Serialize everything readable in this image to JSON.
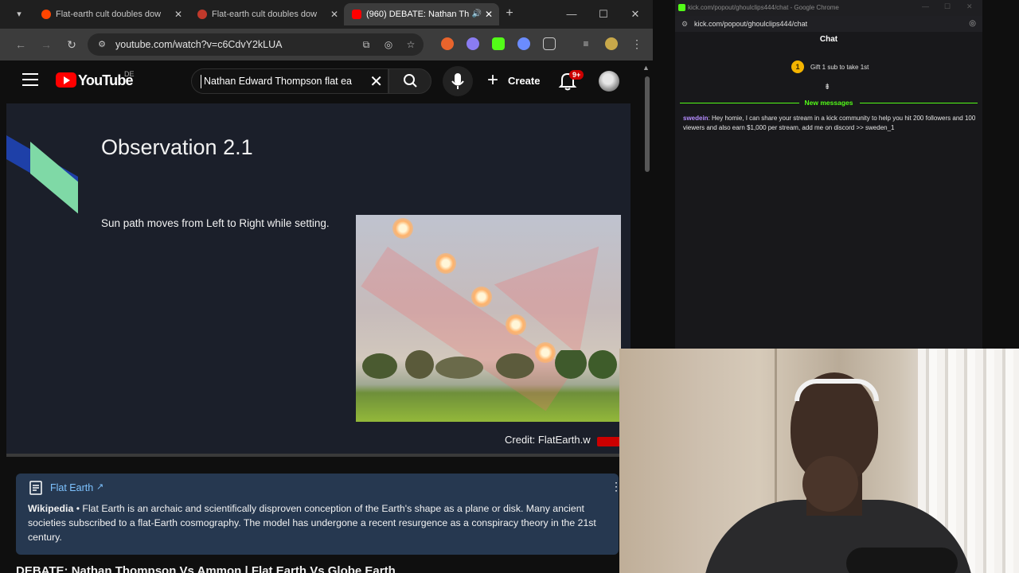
{
  "browser": {
    "tabs": [
      {
        "title": "Flat-earth cult doubles dow",
        "favicon_color": "#ff4500",
        "active": false
      },
      {
        "title": "Flat-earth cult doubles dow",
        "favicon_color": "#c0392b",
        "active": false
      },
      {
        "title": "(960) DEBATE: Nathan Th",
        "favicon_color": "#ff0000",
        "active": true
      }
    ],
    "url": "youtube.com/watch?v=c6CdvY2kLUA"
  },
  "youtube": {
    "logo_text": "YouTube",
    "region": "DE",
    "search_query": "Nathan Edward Thompson flat ea",
    "create_label": "Create",
    "notification_badge": "9+"
  },
  "video": {
    "slide_title": "Observation 2.1",
    "slide_subtitle": "Sun path moves from Left to Right while setting.",
    "credit": "Credit: FlatEarth.w"
  },
  "info_panel": {
    "link_text": "Flat Earth",
    "source": "Wikipedia",
    "description": " • Flat Earth is an archaic and scientifically disproven conception of the Earth's shape as a plane or disk. Many ancient societies subscribed to a flat-Earth cosmography. The model has undergone a recent resurgence as a conspiracy theory in the 21st century."
  },
  "video_title": "DEBATE: Nathan Thompson Vs Ammon | Flat Earth Vs Globe Earth",
  "chat_window": {
    "window_title": "kick.com/popout/ghoulclips444/chat - Google Chrome",
    "url": "kick.com/popout/ghoulclips444/chat",
    "header": "Chat",
    "gift_badge": "1",
    "gift_text": "Gift 1 sub to take 1st",
    "new_messages_label": "New messages",
    "message": {
      "user": "swedein",
      "text": ": Hey homie, I can share your stream in a kick community to help you hit 200 followers and 100 viewers and also earn $1,000 per stream, add me on discord >> sweden_1"
    }
  }
}
